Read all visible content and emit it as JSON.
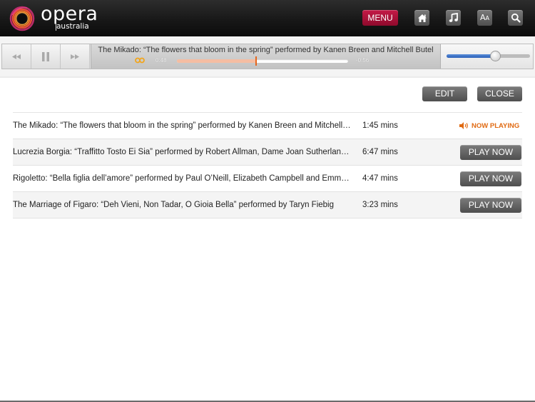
{
  "header": {
    "logo_word": "opera",
    "logo_sub": "australia",
    "menu_label": "MENU",
    "buttons": [
      {
        "name": "home",
        "icon": "home-icon"
      },
      {
        "name": "music",
        "icon": "music-note-icon"
      },
      {
        "name": "text-size",
        "icon": "text-size-icon",
        "label_big": "A",
        "label_small": "A"
      },
      {
        "name": "search",
        "icon": "search-icon"
      }
    ]
  },
  "player": {
    "controls": [
      "rewind-icon",
      "pause-icon",
      "fast-forward-icon"
    ],
    "now_playing_title": "The Mikado: “The flowers that bloom in the spring” performed by Kanen Breen and Mitchell Butel",
    "elapsed": "0:48",
    "remaining": "-0:56",
    "progress_fraction": 0.46,
    "volume_fraction": 0.58,
    "colors": {
      "progress_fill": "#f5bda2",
      "progress_thumb": "#e5661d",
      "volume_fill": "#2a5fb8"
    }
  },
  "actions": {
    "edit_label": "EDIT",
    "close_label": "CLOSE"
  },
  "playlist": [
    {
      "title": "The Mikado: “The flowers that bloom in the spring” performed by Kanen Breen and Mitchell Butel",
      "duration": "1:45 mins",
      "status": "NOW PLAYING",
      "is_playing": true
    },
    {
      "title": "Lucrezia Borgia: “Traffitto Tosto Ei Sia” performed by Robert Allman, Dame Joan Sutherland and Ron…",
      "duration": "6:47 mins",
      "action": "PLAY NOW",
      "is_playing": false
    },
    {
      "title": "Rigoletto: “Bella figlia dell’amore” performed by Paul O’Neill, Elizabeth Campbell and Emma Matthews",
      "duration": "4:47 mins",
      "action": "PLAY NOW",
      "is_playing": false
    },
    {
      "title": "The Marriage of Figaro: “Deh Vieni, Non Tadar, O Gioia Bella” performed by Taryn Fiebig",
      "duration": "3:23 mins",
      "action": "PLAY NOW",
      "is_playing": false
    }
  ],
  "colors": {
    "menu_accent": "#b0113c",
    "now_playing": "#e06a12"
  }
}
